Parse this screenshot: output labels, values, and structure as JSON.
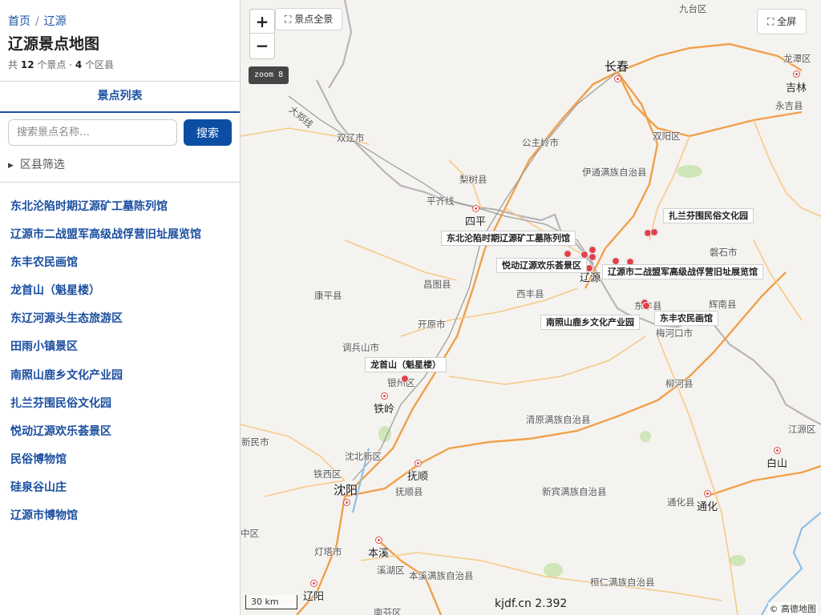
{
  "breadcrumb": {
    "home": "首页",
    "separator": "/",
    "current": "辽源"
  },
  "page_title": "辽源景点地图",
  "summary": {
    "prefix": "共",
    "spot_count": "12",
    "spot_unit": "个景点 ·",
    "district_count": "4",
    "district_unit": "个区县"
  },
  "tab": {
    "label": "景点列表"
  },
  "search": {
    "placeholder": "搜索景点名称…",
    "value": "",
    "button_label": "搜索"
  },
  "filter": {
    "label": "区县筛选",
    "icon": "caret-right-icon"
  },
  "spots": [
    "东北沦陷时期辽源矿工墓陈列馆",
    "辽源市二战盟军高级战俘营旧址展览馆",
    "东丰农民画馆",
    "龙首山（魁星楼）",
    "东辽河源头生态旅游区",
    "田雨小镇景区",
    "南照山鹿乡文化产业园",
    "扎兰芬围民俗文化园",
    "悦动辽源欢乐荟景区",
    "民俗博物馆",
    "硅泉谷山庄",
    "辽源市博物馆"
  ],
  "map": {
    "zoom_in": "+",
    "zoom_out": "−",
    "overview_label": "景点全景",
    "overview_icon": "expand-icon",
    "fullscreen_label": "全屏",
    "fullscreen_icon": "expand-icon",
    "zoom_badge": "zoom 8",
    "scale": "30 km",
    "version": "kjdf.cn 2.392",
    "copyright": "© 高德地图",
    "spot_labels": {
      "kuanggong": "东北沦陷时期辽源矿工墓陈列馆",
      "yuedong": "悦动辽源欢乐荟景区",
      "zhanlan": "扎兰芬围民俗文化园",
      "zhanfu": "辽源市二战盟军高级战俘营旧址展览馆",
      "nanzhao": "南照山鹿乡文化产业园",
      "dongfeng": "东丰农民画馆",
      "longshou": "龙首山（魁星楼）"
    },
    "places": {
      "changchun": "长春",
      "jilin": "吉林",
      "siping": "四平",
      "liaoyuan": "辽源",
      "tieling": "铁岭",
      "shenyang": "沈阳",
      "fushun": "抚顺",
      "benxi": "本溪",
      "liaoyang": "辽阳",
      "tonghua": "通化",
      "baishan": "白山",
      "jiutai": "九台区",
      "longtan": "龙潭区",
      "yongji": "永吉县",
      "shuangliao": "双辽市",
      "gongzhuling": "公主岭市",
      "shuangyang": "双阳区",
      "yitong": "伊通满族自治县",
      "lishu": "梨树县",
      "panshi": "磐石市",
      "kangping": "康平县",
      "changtu": "昌图县",
      "xifeng": "西丰县",
      "dongfengx": "东丰县",
      "huinan": "辉南县",
      "kaiyuan": "开原市",
      "meihekou": "梅河口市",
      "diaobingshan": "调兵山市",
      "yinzhou": "银州区",
      "liuhe": "柳河县",
      "qingyuan": "清原满族自治县",
      "xinmin": "新民市",
      "shenbei": "沈北新区",
      "tiexi": "铁西区",
      "fushunx": "抚顺县",
      "xinbin": "新宾满族自治县",
      "tonghuax": "通化县",
      "jiangyuan": "江源区",
      "dengta": "灯塔市",
      "xihu": "溪湖区",
      "benxix": "本溪满族自治县",
      "huanren": "桓仁满族自治县",
      "pingqi": "平齐线",
      "dazheng": "大郑线",
      "zhongqu": "中区",
      "nanfen": "南芬区"
    }
  },
  "colors": {
    "accent": "#1b4fa0",
    "button": "#0c4ea3",
    "marker": "#e0424a"
  }
}
